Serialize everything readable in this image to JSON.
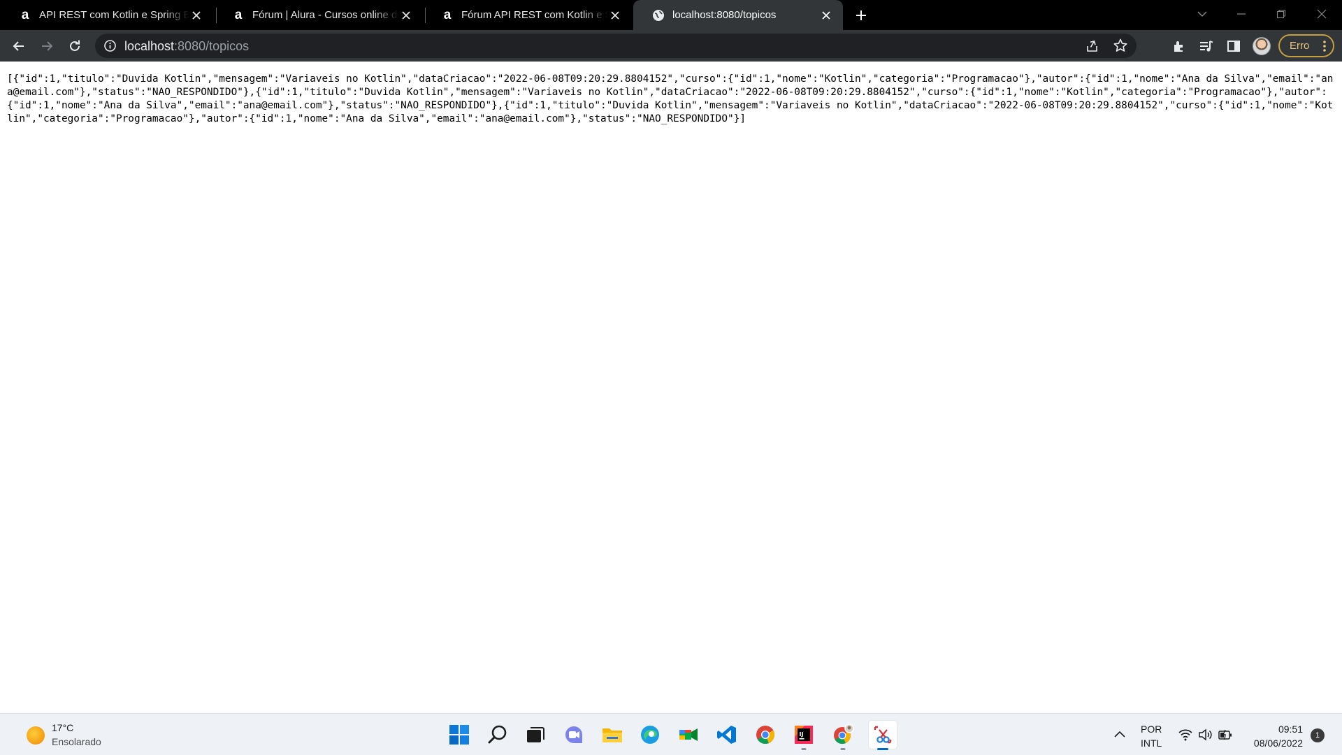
{
  "browser": {
    "tabs": [
      {
        "title": "API REST com Kotlin e Spring Boot",
        "favicon": "alura-icon"
      },
      {
        "title": "Fórum | Alura - Cursos online de tecnologia",
        "favicon": "alura-icon"
      },
      {
        "title": "Fórum API REST com Kotlin e Spring Boot",
        "favicon": "alura-icon"
      },
      {
        "title": "localhost:8080/topicos",
        "favicon": "globe-icon",
        "active": true
      }
    ],
    "address": {
      "host": "localhost",
      "path": ":8080/topicos"
    },
    "profile_error_label": "Erro",
    "colors": {
      "tabstrip": "#000000",
      "toolbar": "#323639",
      "omnibox": "#202124",
      "error_chip": "#c5a03f"
    }
  },
  "page": {
    "json_text": "[{\"id\":1,\"titulo\":\"Duvida Kotlin\",\"mensagem\":\"Variaveis no Kotlin\",\"dataCriacao\":\"2022-06-08T09:20:29.8804152\",\"curso\":{\"id\":1,\"nome\":\"Kotlin\",\"categoria\":\"Programacao\"},\"autor\":{\"id\":1,\"nome\":\"Ana da Silva\",\"email\":\"ana@email.com\"},\"status\":\"NAO_RESPONDIDO\"},{\"id\":1,\"titulo\":\"Duvida Kotlin\",\"mensagem\":\"Variaveis no Kotlin\",\"dataCriacao\":\"2022-06-08T09:20:29.8804152\",\"curso\":{\"id\":1,\"nome\":\"Kotlin\",\"categoria\":\"Programacao\"},\"autor\":{\"id\":1,\"nome\":\"Ana da Silva\",\"email\":\"ana@email.com\"},\"status\":\"NAO_RESPONDIDO\"},{\"id\":1,\"titulo\":\"Duvida Kotlin\",\"mensagem\":\"Variaveis no Kotlin\",\"dataCriacao\":\"2022-06-08T09:20:29.8804152\",\"curso\":{\"id\":1,\"nome\":\"Kotlin\",\"categoria\":\"Programacao\"},\"autor\":{\"id\":1,\"nome\":\"Ana da Silva\",\"email\":\"ana@email.com\"},\"status\":\"NAO_RESPONDIDO\"}]"
  },
  "taskbar": {
    "weather": {
      "temp": "17°C",
      "desc": "Ensolarado",
      "icon": "sun-icon"
    },
    "apps": [
      {
        "name": "windows-start-icon"
      },
      {
        "name": "search-icon"
      },
      {
        "name": "task-view-icon"
      },
      {
        "name": "teams-chat-icon"
      },
      {
        "name": "file-explorer-icon"
      },
      {
        "name": "edge-icon"
      },
      {
        "name": "meet-icon"
      },
      {
        "name": "vscode-icon"
      },
      {
        "name": "chrome-icon"
      },
      {
        "name": "intellij-icon",
        "running": true
      },
      {
        "name": "chrome-profile-icon",
        "running": true
      },
      {
        "name": "snipping-tool-icon",
        "running": true,
        "active": true
      }
    ],
    "language": {
      "line1": "POR",
      "line2": "INTL"
    },
    "clock": {
      "time": "09:51",
      "date": "08/06/2022"
    },
    "notifications": "1"
  }
}
